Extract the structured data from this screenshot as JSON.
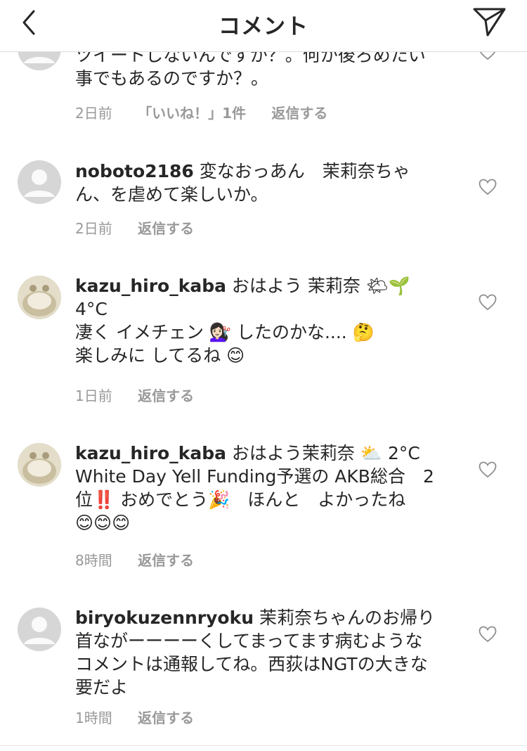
{
  "header": {
    "title": "コメント",
    "back_icon": "chevron-left-icon",
    "share_icon": "paper-plane-icon"
  },
  "comments": [
    {
      "username": "",
      "lines": [
        "ツイートしないんですか？。何か後ろめたい",
        "事でもあるのですか？。"
      ],
      "time": "2日前",
      "likes": "「いいね！」1件",
      "reply": "返信する",
      "avatar": "default"
    },
    {
      "username": "noboto2186",
      "lines": [
        " 変なおっあん　茉莉奈ちゃ",
        "ん、を虐めて楽しいか。"
      ],
      "time": "2日前",
      "reply": "返信する",
      "avatar": "default"
    },
    {
      "username": "kazu_hiro_kaba",
      "lines": [
        " おはよう 茉莉奈 🌤🌱",
        "4°C",
        "凄く イメチェン 💇🏻‍♀️ したのかな.... 🤔",
        "楽しみに してるね 😊"
      ],
      "time": "1日前",
      "reply": "返信する",
      "avatar": "photo"
    },
    {
      "username": "kazu_hiro_kaba",
      "lines": [
        " おはよう茉莉奈 ⛅ 2°C",
        "White Day Yell Funding予選の AKB総合　2",
        "位‼️ おめでとう🎉　ほんと　よかったね",
        "😊😊😊"
      ],
      "time": "8時間",
      "reply": "返信する",
      "avatar": "photo"
    },
    {
      "username": "biryokuzennryoku",
      "lines": [
        " 茉莉奈ちゃんのお帰り",
        "首ながーーーーくしてまってます病むような",
        "コメントは通報してね。西荻はNGTの大きな",
        "要だよ"
      ],
      "time": "1時間",
      "reply": "返信する",
      "avatar": "default"
    }
  ]
}
